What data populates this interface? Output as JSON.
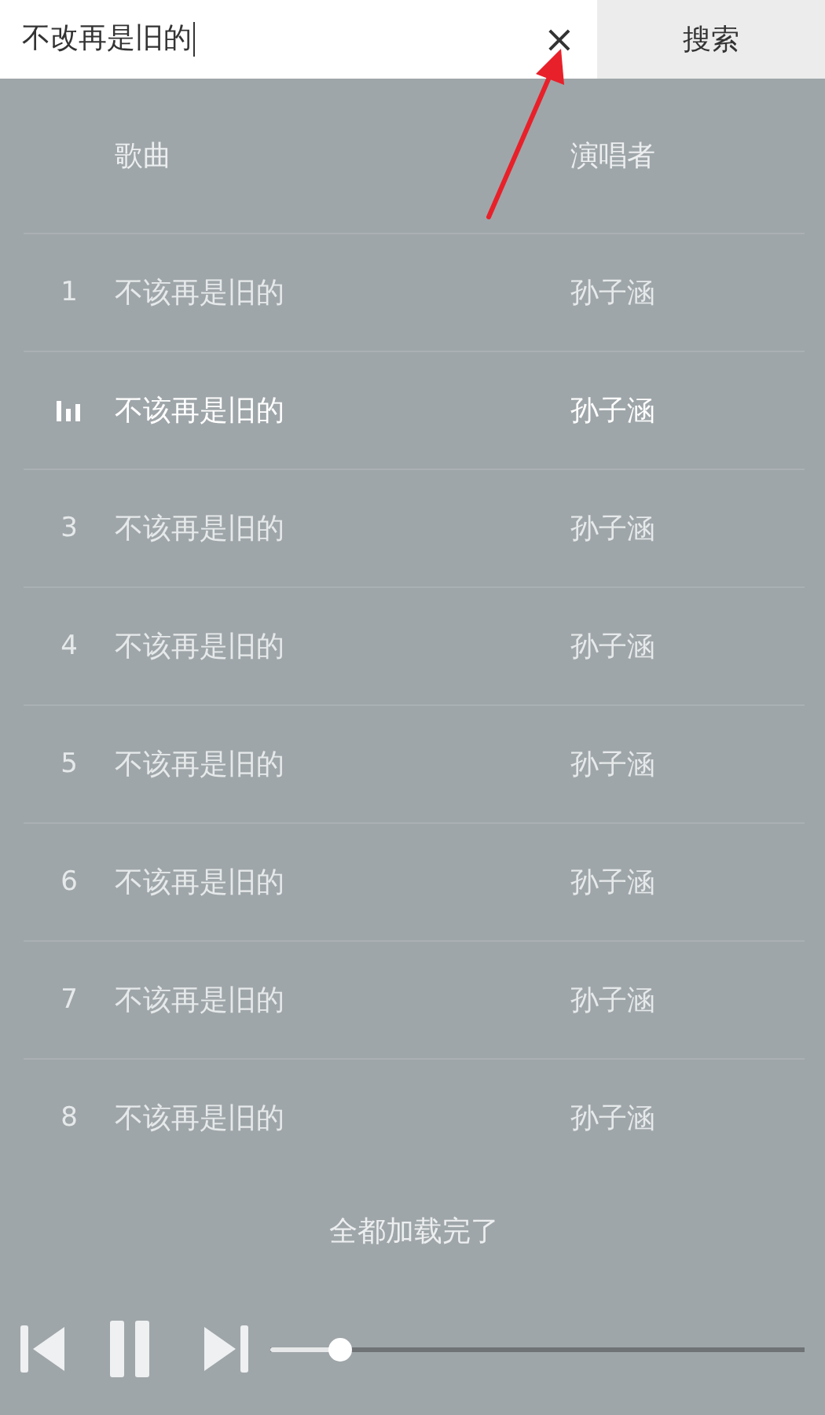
{
  "search": {
    "value": "不改再是旧的",
    "clear_label": "×",
    "button": "搜索"
  },
  "table": {
    "columns": [
      "歌曲",
      "演唱者"
    ],
    "rows": [
      {
        "number": "1",
        "title": "不该再是旧的",
        "artist": "孙子涵",
        "playing": false
      },
      {
        "title": "不该再是旧的",
        "artist": "孙子涵",
        "playing": true
      },
      {
        "number": "3",
        "title": "不该再是旧的",
        "artist": "孙子涵",
        "playing": false
      },
      {
        "number": "4",
        "title": "不该再是旧的",
        "artist": "孙子涵",
        "playing": false
      },
      {
        "number": "5",
        "title": "不该再是旧的",
        "artist": "孙子涵",
        "playing": false
      },
      {
        "number": "6",
        "title": "不该再是旧的",
        "artist": "孙子涵",
        "playing": false
      },
      {
        "number": "7",
        "title": "不该再是旧的",
        "artist": "孙子涵",
        "playing": false
      },
      {
        "number": "8",
        "title": "不该再是旧的",
        "artist": "孙子涵",
        "playing": false
      }
    ]
  },
  "footer": "全都加载完了",
  "player": {
    "playing": true,
    "level": 0.13
  }
}
